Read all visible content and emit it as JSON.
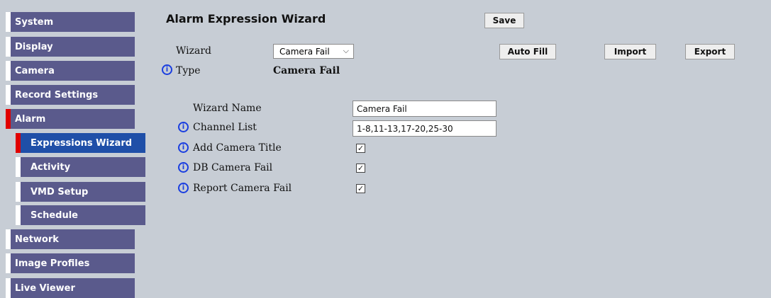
{
  "sidebar": {
    "items": [
      {
        "label": "System"
      },
      {
        "label": "Display"
      },
      {
        "label": "Camera"
      },
      {
        "label": "Record Settings"
      },
      {
        "label": "Alarm"
      },
      {
        "label": "Expressions Wizard"
      },
      {
        "label": "Activity"
      },
      {
        "label": "VMD Setup"
      },
      {
        "label": "Schedule"
      },
      {
        "label": "Network"
      },
      {
        "label": "Image Profiles"
      },
      {
        "label": "Live Viewer"
      }
    ],
    "active_item": "Expressions Wizard"
  },
  "header": {
    "title": "Alarm Expression Wizard",
    "save_label": "Save"
  },
  "toolbar": {
    "auto_fill_label": "Auto Fill",
    "import_label": "Import",
    "export_label": "Export"
  },
  "wizard": {
    "label": "Wizard",
    "selected": "Camera Fail",
    "type_label": "Type",
    "type_value": "Camera Fail"
  },
  "form": {
    "wizard_name_label": "Wizard Name",
    "wizard_name_value": "Camera Fail",
    "channel_list_label": "Channel List",
    "channel_list_value": "1-8,11-13,17-20,25-30",
    "add_camera_title_label": "Add Camera Title",
    "add_camera_title_checked": true,
    "db_camera_fail_label": "DB Camera Fail",
    "db_camera_fail_checked": true,
    "report_camera_fail_label": "Report Camera Fail",
    "report_camera_fail_checked": true
  },
  "icons": {
    "info": "info-icon",
    "dropdown": "chevron-down-icon",
    "check": "check-icon"
  },
  "colors": {
    "page_background": "#c7cdd5",
    "nav_background": "#5a5a8c",
    "nav_active": "#1f4fa8",
    "nav_marker": "#e00000",
    "info_blue": "#1a3ee0"
  }
}
